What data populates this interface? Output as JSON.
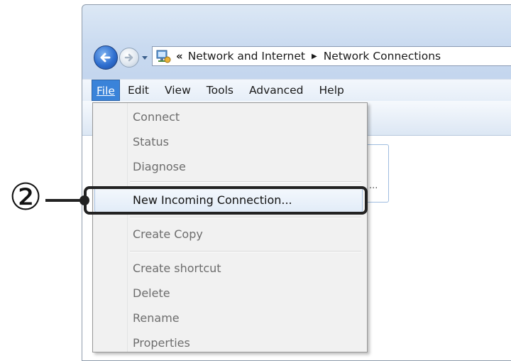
{
  "address": {
    "overflow_chevron": "«",
    "breadcrumbs": [
      "Network and Internet",
      "Network Connections"
    ],
    "separator": "▶"
  },
  "menubar": {
    "items": [
      {
        "label": "File",
        "active": true
      },
      {
        "label": "Edit"
      },
      {
        "label": "View"
      },
      {
        "label": "Tools"
      },
      {
        "label": "Advanced"
      },
      {
        "label": "Help"
      }
    ]
  },
  "file_menu": {
    "items": [
      {
        "label": "Connect",
        "enabled": false
      },
      {
        "label": "Status",
        "enabled": false
      },
      {
        "label": "Diagnose",
        "enabled": false
      },
      {
        "label": "New Incoming Connection...",
        "enabled": true,
        "highlighted": true
      },
      {
        "label": "Create Copy",
        "enabled": false
      },
      {
        "label": "Create shortcut",
        "enabled": false
      },
      {
        "label": "Delete",
        "enabled": false
      },
      {
        "label": "Rename",
        "enabled": false
      },
      {
        "label": "Properties",
        "enabled": false
      }
    ]
  },
  "content": {
    "tile_ellipsis": "..."
  },
  "callout": {
    "number": "②"
  },
  "colors": {
    "menu_active": "#3a83d9",
    "callout": "#222222"
  }
}
